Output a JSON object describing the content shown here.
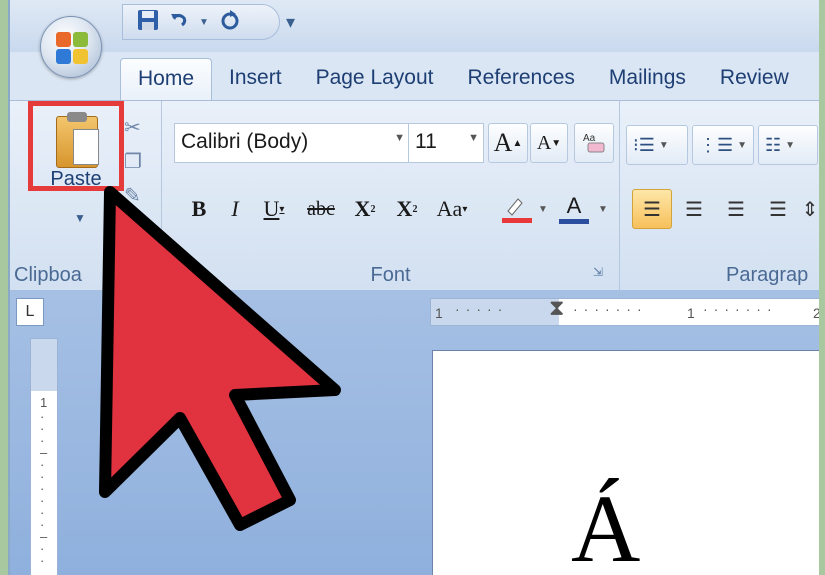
{
  "quick_access": {
    "save_icon": "save-icon",
    "undo_icon": "undo-icon",
    "redo_icon": "redo-icon",
    "customize_icon": "customize-qat-icon"
  },
  "tabs": [
    {
      "label": "Home",
      "active": true
    },
    {
      "label": "Insert"
    },
    {
      "label": "Page Layout"
    },
    {
      "label": "References"
    },
    {
      "label": "Mailings"
    },
    {
      "label": "Review"
    }
  ],
  "clipboard": {
    "paste_label": "Paste",
    "group_label": "Clipboa",
    "highlight_color": "#e53b3b"
  },
  "font": {
    "family": "Calibri (Body)",
    "size": "11",
    "grow": "A",
    "shrink": "A",
    "bold": "B",
    "italic": "I",
    "underline": "U",
    "strikethrough": "abc",
    "subscript": "X",
    "superscript": "X",
    "change_case": "Aa",
    "font_color_letter": "A",
    "group_label": "Font"
  },
  "paragraph": {
    "group_label": "Paragrap"
  },
  "ruler": {
    "h_labels": [
      "1",
      "1",
      "2"
    ],
    "v_label": "1",
    "toggle_glyph": "L"
  },
  "document": {
    "text": "Á"
  },
  "colors": {
    "pointer_fill": "#e0323f",
    "highlight_text": "#e8383a",
    "font_color": "#2b4f9e"
  }
}
